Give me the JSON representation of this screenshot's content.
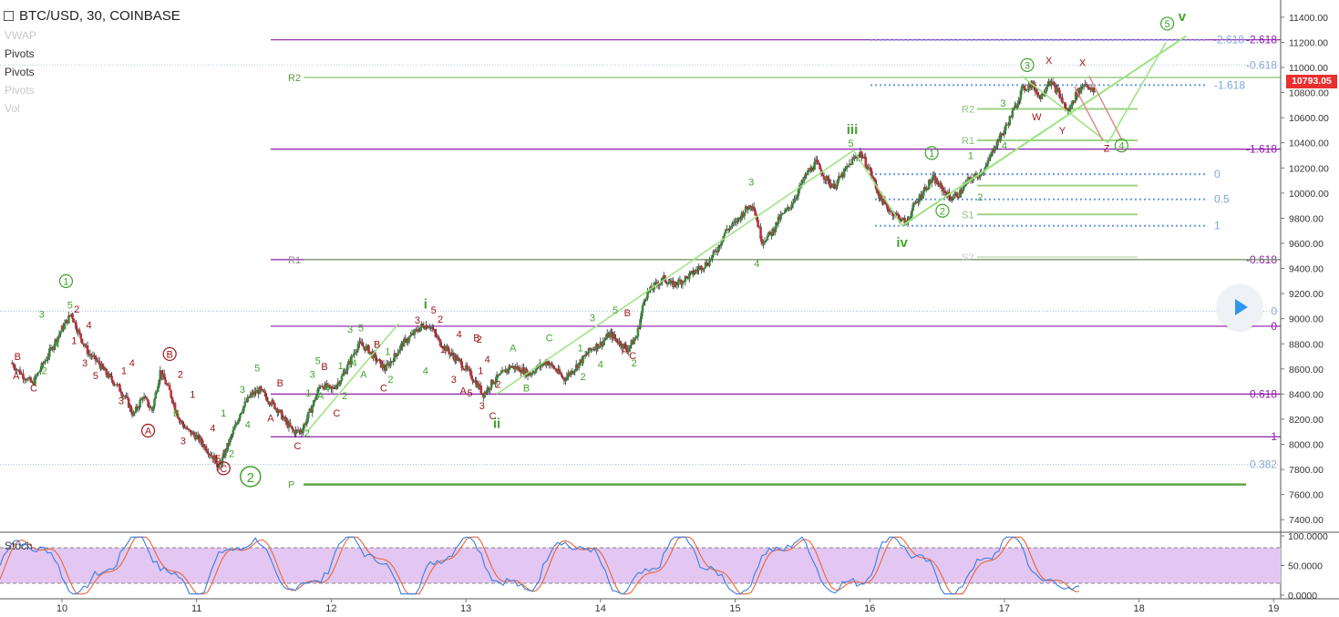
{
  "header": {
    "title": "BTC/USD, 30, COINBASE"
  },
  "indicators": [
    {
      "label": "VWAP",
      "visible": false
    },
    {
      "label": "Pivots",
      "visible": true
    },
    {
      "label": "Pivots",
      "visible": true
    },
    {
      "label": "Pivots",
      "visible": false
    },
    {
      "label": "Vol",
      "visible": false
    }
  ],
  "current_price": "10793.05",
  "colors": {
    "purple": "#8b1ea8",
    "green": "#3fa42a",
    "lightgreen": "#9be37f",
    "red": "#a01616",
    "blue": "#6d9be0",
    "stochbg": "#e3c7f2",
    "badge": "#e9302e"
  },
  "chart_data": {
    "type": "candlestick",
    "symbol": "BTC/USD",
    "interval": "30",
    "exchange": "COINBASE",
    "y_axis": {
      "min": 7300,
      "max": 11450,
      "ticks": [
        7400,
        7600,
        7800,
        8000,
        8200,
        8400,
        8600,
        8800,
        9000,
        9200,
        9400,
        9600,
        9800,
        10000,
        10200,
        10400,
        10600,
        10800,
        11000,
        11200,
        11400
      ]
    },
    "x_axis": {
      "ticks": [
        "10",
        "11",
        "12",
        "13",
        "14",
        "15",
        "16",
        "17",
        "18",
        "19"
      ],
      "range": [
        9.62,
        19.03
      ]
    },
    "price_path": [
      [
        9.62,
        8650
      ],
      [
        9.7,
        8560
      ],
      [
        9.78,
        8480
      ],
      [
        9.85,
        8620
      ],
      [
        9.93,
        8780
      ],
      [
        10.0,
        8920
      ],
      [
        10.07,
        9040
      ],
      [
        10.13,
        8870
      ],
      [
        10.2,
        8720
      ],
      [
        10.27,
        8650
      ],
      [
        10.33,
        8560
      ],
      [
        10.4,
        8480
      ],
      [
        10.47,
        8380
      ],
      [
        10.53,
        8230
      ],
      [
        10.6,
        8380
      ],
      [
        10.67,
        8270
      ],
      [
        10.73,
        8580
      ],
      [
        10.8,
        8420
      ],
      [
        10.87,
        8200
      ],
      [
        10.93,
        8110
      ],
      [
        11.0,
        8060
      ],
      [
        11.07,
        7970
      ],
      [
        11.13,
        7890
      ],
      [
        11.17,
        7820
      ],
      [
        11.22,
        7960
      ],
      [
        11.28,
        8120
      ],
      [
        11.33,
        8270
      ],
      [
        11.4,
        8390
      ],
      [
        11.47,
        8430
      ],
      [
        11.53,
        8360
      ],
      [
        11.6,
        8280
      ],
      [
        11.66,
        8180
      ],
      [
        11.72,
        8100
      ],
      [
        11.78,
        8110
      ],
      [
        11.85,
        8280
      ],
      [
        11.92,
        8480
      ],
      [
        12.0,
        8430
      ],
      [
        12.07,
        8520
      ],
      [
        12.13,
        8640
      ],
      [
        12.2,
        8800
      ],
      [
        12.27,
        8760
      ],
      [
        12.33,
        8680
      ],
      [
        12.4,
        8600
      ],
      [
        12.47,
        8700
      ],
      [
        12.53,
        8800
      ],
      [
        12.6,
        8870
      ],
      [
        12.67,
        8940
      ],
      [
        12.73,
        8950
      ],
      [
        12.8,
        8820
      ],
      [
        12.87,
        8740
      ],
      [
        12.93,
        8680
      ],
      [
        13.0,
        8600
      ],
      [
        13.07,
        8500
      ],
      [
        13.13,
        8400
      ],
      [
        13.2,
        8500
      ],
      [
        13.27,
        8560
      ],
      [
        13.33,
        8620
      ],
      [
        13.4,
        8600
      ],
      [
        13.47,
        8560
      ],
      [
        13.53,
        8610
      ],
      [
        13.6,
        8660
      ],
      [
        13.67,
        8590
      ],
      [
        13.73,
        8520
      ],
      [
        13.8,
        8600
      ],
      [
        13.87,
        8680
      ],
      [
        13.93,
        8760
      ],
      [
        14.0,
        8800
      ],
      [
        14.07,
        8880
      ],
      [
        14.13,
        8820
      ],
      [
        14.2,
        8760
      ],
      [
        14.27,
        8860
      ],
      [
        14.33,
        9180
      ],
      [
        14.4,
        9260
      ],
      [
        14.47,
        9320
      ],
      [
        14.53,
        9270
      ],
      [
        14.6,
        9300
      ],
      [
        14.67,
        9350
      ],
      [
        14.73,
        9400
      ],
      [
        14.8,
        9450
      ],
      [
        14.87,
        9560
      ],
      [
        14.93,
        9700
      ],
      [
        15.0,
        9760
      ],
      [
        15.07,
        9860
      ],
      [
        15.13,
        9920
      ],
      [
        15.2,
        9620
      ],
      [
        15.27,
        9680
      ],
      [
        15.33,
        9800
      ],
      [
        15.4,
        9880
      ],
      [
        15.47,
        10020
      ],
      [
        15.53,
        10150
      ],
      [
        15.6,
        10240
      ],
      [
        15.67,
        10120
      ],
      [
        15.73,
        10050
      ],
      [
        15.8,
        10150
      ],
      [
        15.87,
        10260
      ],
      [
        15.93,
        10320
      ],
      [
        16.0,
        10180
      ],
      [
        16.07,
        9980
      ],
      [
        16.13,
        9880
      ],
      [
        16.2,
        9820
      ],
      [
        16.27,
        9760
      ],
      [
        16.33,
        9900
      ],
      [
        16.4,
        10020
      ],
      [
        16.47,
        10120
      ],
      [
        16.53,
        10040
      ],
      [
        16.6,
        9960
      ],
      [
        16.67,
        10000
      ],
      [
        16.73,
        10100
      ],
      [
        16.8,
        10140
      ],
      [
        16.87,
        10220
      ],
      [
        16.93,
        10380
      ],
      [
        17.0,
        10500
      ],
      [
        17.07,
        10660
      ],
      [
        17.13,
        10820
      ],
      [
        17.2,
        10870
      ],
      [
        17.27,
        10760
      ],
      [
        17.33,
        10900
      ],
      [
        17.4,
        10800
      ],
      [
        17.47,
        10640
      ],
      [
        17.53,
        10780
      ],
      [
        17.6,
        10880
      ],
      [
        17.67,
        10793
      ]
    ],
    "fib_lines": [
      {
        "price": 11220,
        "label": "-2.618",
        "color": "purple"
      },
      {
        "price": 10350,
        "label": "-1.618",
        "color": "purple"
      },
      {
        "price": 9470,
        "label": "-0.618",
        "color": "purple"
      },
      {
        "price": 8940,
        "label": "0",
        "color": "purple"
      },
      {
        "price": 8400,
        "label": "0.618",
        "color": "purple"
      },
      {
        "price": 8060,
        "label": "1",
        "color": "purple"
      }
    ],
    "fib_dotted": [
      {
        "price": 11220,
        "label": "-2.618",
        "color": "blue"
      },
      {
        "price": 10860,
        "label": "-1.618",
        "color": "blue"
      },
      {
        "price": 10150,
        "label": "0",
        "color": "blue"
      },
      {
        "price": 9950,
        "label": "0.5",
        "color": "blue"
      },
      {
        "price": 9740,
        "label": "1",
        "color": "blue"
      }
    ],
    "faint_lines": [
      {
        "price": 11020,
        "label": "-0.618"
      },
      {
        "price": 9060,
        "label": "0"
      },
      {
        "price": 7840,
        "label": "0.382"
      }
    ],
    "pivots_main": [
      {
        "label": "R2",
        "price": 10920
      },
      {
        "label": "R1",
        "price": 9470
      },
      {
        "label": "P",
        "price": 7680
      }
    ],
    "pivots_small": [
      {
        "label": "R2",
        "price": 10670
      },
      {
        "label": "R1",
        "price": 10420
      },
      {
        "label": "",
        "price": 10060
      },
      {
        "label": "S1",
        "price": 9830
      },
      {
        "label": "S2",
        "price": 9490
      }
    ],
    "wave_labels": [
      {
        "t": "1",
        "x": 10.03,
        "p": 9270,
        "c": "green",
        "s": "circle"
      },
      {
        "t": "5",
        "x": 10.06,
        "p": 9080,
        "c": "green"
      },
      {
        "t": "2",
        "x": 10.11,
        "p": 9050,
        "c": "red"
      },
      {
        "t": "3",
        "x": 9.85,
        "p": 9010,
        "c": "green"
      },
      {
        "t": "4",
        "x": 9.96,
        "p": 8770,
        "c": "green"
      },
      {
        "t": "1",
        "x": 10.09,
        "p": 8800,
        "c": "red"
      },
      {
        "t": "4",
        "x": 10.2,
        "p": 8920,
        "c": "red"
      },
      {
        "t": "3",
        "x": 10.17,
        "p": 8620,
        "c": "red"
      },
      {
        "t": "5",
        "x": 10.25,
        "p": 8520,
        "c": "red"
      },
      {
        "t": "2",
        "x": 9.87,
        "p": 8560,
        "c": "green"
      },
      {
        "t": "B",
        "x": 9.67,
        "p": 8670,
        "c": "red"
      },
      {
        "t": "A",
        "x": 9.66,
        "p": 8520,
        "c": "red"
      },
      {
        "t": "C",
        "x": 9.79,
        "p": 8420,
        "c": "red"
      },
      {
        "t": "B",
        "x": 10.8,
        "p": 8690,
        "c": "red",
        "s": "circle"
      },
      {
        "t": "4",
        "x": 10.52,
        "p": 8620,
        "c": "red"
      },
      {
        "t": "1",
        "x": 10.46,
        "p": 8560,
        "c": "red"
      },
      {
        "t": "2",
        "x": 10.88,
        "p": 8530,
        "c": "red"
      },
      {
        "t": "3",
        "x": 10.44,
        "p": 8320,
        "c": "red"
      },
      {
        "t": "B",
        "x": 10.85,
        "p": 8220,
        "c": "green"
      },
      {
        "t": "A",
        "x": 10.64,
        "p": 8080,
        "c": "red",
        "s": "circle"
      },
      {
        "t": "1",
        "x": 10.97,
        "p": 8370,
        "c": "red"
      },
      {
        "t": "3",
        "x": 10.9,
        "p": 8000,
        "c": "red"
      },
      {
        "t": "4",
        "x": 11.12,
        "p": 8100,
        "c": "red"
      },
      {
        "t": "5",
        "x": 11.16,
        "p": 7860,
        "c": "red"
      },
      {
        "t": "C",
        "x": 11.2,
        "p": 7780,
        "c": "red",
        "s": "circle"
      },
      {
        "t": "2",
        "x": 11.4,
        "p": 7700,
        "c": "green",
        "s": "bigcircle"
      },
      {
        "t": "1",
        "x": 11.2,
        "p": 8220,
        "c": "green"
      },
      {
        "t": "2",
        "x": 11.26,
        "p": 7900,
        "c": "green"
      },
      {
        "t": "3",
        "x": 11.34,
        "p": 8410,
        "c": "green"
      },
      {
        "t": "4",
        "x": 11.38,
        "p": 8130,
        "c": "green"
      },
      {
        "t": "5",
        "x": 11.45,
        "p": 8580,
        "c": "green"
      },
      {
        "t": "B",
        "x": 11.62,
        "p": 8460,
        "c": "red"
      },
      {
        "t": "A",
        "x": 11.55,
        "p": 8180,
        "c": "red"
      },
      {
        "t": "C",
        "x": 11.75,
        "p": 7960,
        "c": "red"
      },
      {
        "t": "2",
        "x": 11.82,
        "p": 8060,
        "c": "green"
      },
      {
        "t": "5",
        "x": 11.9,
        "p": 8640,
        "c": "green"
      },
      {
        "t": "3",
        "x": 11.86,
        "p": 8530,
        "c": "green"
      },
      {
        "t": "B",
        "x": 11.95,
        "p": 8590,
        "c": "red"
      },
      {
        "t": "1",
        "x": 11.83,
        "p": 8380,
        "c": "green"
      },
      {
        "t": "A",
        "x": 11.92,
        "p": 8360,
        "c": "green"
      },
      {
        "t": "4",
        "x": 11.97,
        "p": 8420,
        "c": "green"
      },
      {
        "t": "2",
        "x": 12.1,
        "p": 8360,
        "c": "green"
      },
      {
        "t": "C",
        "x": 12.04,
        "p": 8220,
        "c": "red"
      },
      {
        "t": "1",
        "x": 12.07,
        "p": 8600,
        "c": "green"
      },
      {
        "t": "3",
        "x": 12.14,
        "p": 8890,
        "c": "green"
      },
      {
        "t": "5",
        "x": 12.22,
        "p": 8900,
        "c": "green"
      },
      {
        "t": "4",
        "x": 12.17,
        "p": 8620,
        "c": "green"
      },
      {
        "t": "B",
        "x": 12.34,
        "p": 8770,
        "c": "red"
      },
      {
        "t": "A",
        "x": 12.24,
        "p": 8530,
        "c": "green"
      },
      {
        "t": "1",
        "x": 12.42,
        "p": 8710,
        "c": "green"
      },
      {
        "t": "C",
        "x": 12.39,
        "p": 8420,
        "c": "red"
      },
      {
        "t": "2",
        "x": 12.44,
        "p": 8490,
        "c": "green"
      },
      {
        "t": "i",
        "x": 12.7,
        "p": 9080,
        "c": "green",
        "s": "bold"
      },
      {
        "t": "5",
        "x": 12.76,
        "p": 9040,
        "c": "red"
      },
      {
        "t": "3",
        "x": 12.64,
        "p": 8960,
        "c": "red"
      },
      {
        "t": "2",
        "x": 12.81,
        "p": 8970,
        "c": "red"
      },
      {
        "t": "4",
        "x": 12.95,
        "p": 8850,
        "c": "red"
      },
      {
        "t": "1",
        "x": 12.83,
        "p": 8730,
        "c": "red"
      },
      {
        "t": "4",
        "x": 12.7,
        "p": 8560,
        "c": "green"
      },
      {
        "t": "3",
        "x": 12.91,
        "p": 8490,
        "c": "red"
      },
      {
        "t": "B",
        "x": 13.08,
        "p": 8820,
        "c": "red"
      },
      {
        "t": "2",
        "x": 13.1,
        "p": 8810,
        "c": "red"
      },
      {
        "t": "4",
        "x": 13.16,
        "p": 8650,
        "c": "red"
      },
      {
        "t": "1",
        "x": 13.11,
        "p": 8560,
        "c": "red"
      },
      {
        "t": "A",
        "x": 12.98,
        "p": 8400,
        "c": "red"
      },
      {
        "t": "5",
        "x": 13.03,
        "p": 8380,
        "c": "red"
      },
      {
        "t": "2",
        "x": 13.24,
        "p": 8450,
        "c": "red"
      },
      {
        "t": "3",
        "x": 13.12,
        "p": 8280,
        "c": "red"
      },
      {
        "t": "C",
        "x": 13.2,
        "p": 8200,
        "c": "red"
      },
      {
        "t": "ii",
        "x": 13.23,
        "p": 8130,
        "c": "green",
        "s": "bold"
      },
      {
        "t": "A",
        "x": 13.35,
        "p": 8740,
        "c": "green"
      },
      {
        "t": "B",
        "x": 13.45,
        "p": 8420,
        "c": "green"
      },
      {
        "t": "C",
        "x": 13.62,
        "p": 8820,
        "c": "green"
      },
      {
        "t": "1",
        "x": 13.85,
        "p": 8740,
        "c": "green"
      },
      {
        "t": "3",
        "x": 13.94,
        "p": 8980,
        "c": "green"
      },
      {
        "t": "2",
        "x": 13.87,
        "p": 8510,
        "c": "green"
      },
      {
        "t": "4",
        "x": 14.0,
        "p": 8610,
        "c": "green"
      },
      {
        "t": "5",
        "x": 14.11,
        "p": 9040,
        "c": "green"
      },
      {
        "t": "B",
        "x": 14.2,
        "p": 9020,
        "c": "red"
      },
      {
        "t": "A",
        "x": 14.18,
        "p": 8720,
        "c": "red"
      },
      {
        "t": "C",
        "x": 14.24,
        "p": 8680,
        "c": "red"
      },
      {
        "t": "2",
        "x": 14.25,
        "p": 8620,
        "c": "green"
      },
      {
        "t": "3",
        "x": 15.12,
        "p": 10060,
        "c": "green"
      },
      {
        "t": "4",
        "x": 15.16,
        "p": 9410,
        "c": "green"
      },
      {
        "t": "iii",
        "x": 15.87,
        "p": 10470,
        "c": "green",
        "s": "bold"
      },
      {
        "t": "5",
        "x": 15.86,
        "p": 10370,
        "c": "green"
      },
      {
        "t": "iv",
        "x": 16.24,
        "p": 9570,
        "c": "green",
        "s": "bold"
      },
      {
        "t": "1",
        "x": 16.46,
        "p": 10290,
        "c": "green",
        "s": "circle"
      },
      {
        "t": "2",
        "x": 16.54,
        "p": 9830,
        "c": "green",
        "s": "circle"
      },
      {
        "t": "1",
        "x": 16.75,
        "p": 10270,
        "c": "green"
      },
      {
        "t": "2",
        "x": 16.82,
        "p": 9940,
        "c": "green"
      },
      {
        "t": "3",
        "x": 16.99,
        "p": 10690,
        "c": "green"
      },
      {
        "t": "4",
        "x": 17.0,
        "p": 10350,
        "c": "green"
      },
      {
        "t": "3",
        "x": 17.17,
        "p": 10990,
        "c": "green",
        "s": "circle"
      },
      {
        "t": "X",
        "x": 17.33,
        "p": 11030,
        "c": "red"
      },
      {
        "t": "W",
        "x": 17.24,
        "p": 10580,
        "c": "red"
      },
      {
        "t": "Y",
        "x": 17.43,
        "p": 10470,
        "c": "red"
      },
      {
        "t": "X",
        "x": 17.58,
        "p": 11010,
        "c": "red"
      },
      {
        "t": "Z",
        "x": 17.76,
        "p": 10330,
        "c": "red"
      },
      {
        "t": "4",
        "x": 17.87,
        "p": 10350,
        "c": "green",
        "s": "circle"
      },
      {
        "t": "5",
        "x": 18.21,
        "p": 11320,
        "c": "green",
        "s": "circle"
      },
      {
        "t": "v",
        "x": 18.32,
        "p": 11370,
        "c": "green",
        "s": "bold"
      }
    ],
    "stoch": {
      "label": "Stoch",
      "ticks": [
        "100.0000",
        "50.0000",
        "0.0000"
      ],
      "upper": 80,
      "lower": 20
    }
  }
}
